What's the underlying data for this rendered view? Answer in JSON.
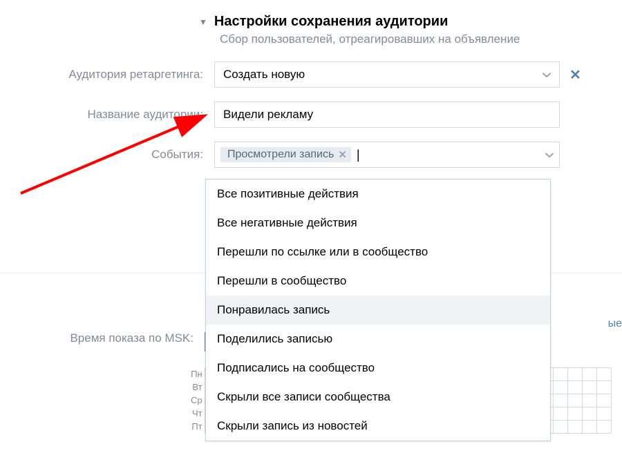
{
  "section": {
    "title": "Настройки сохранения аудитории",
    "subtitle": "Сбор пользователей, отреагировавших на объявление"
  },
  "labels": {
    "retargeting": "Аудитория ретаргетинга:",
    "name": "Название аудитории:",
    "events": "События:",
    "schedule": "Время показа по MSK:"
  },
  "values": {
    "retargeting": "Создать новую",
    "name": "Видели рекламу",
    "tag": "Просмотрели запись"
  },
  "dropdown": {
    "items": [
      "Все позитивные действия",
      "Все негативные действия",
      "Перешли по ссылке или в сообщество",
      "Перешли в сообщество",
      "Понравилась запись",
      "Поделились записью",
      "Подписались на сообщество",
      "Скрыли все записи сообщества",
      "Скрыли запись из новостей"
    ],
    "highlighted_index": 4
  },
  "days": [
    "Пн",
    "Вт",
    "Ср",
    "Чт",
    "Пт"
  ],
  "partial_link": "ые"
}
